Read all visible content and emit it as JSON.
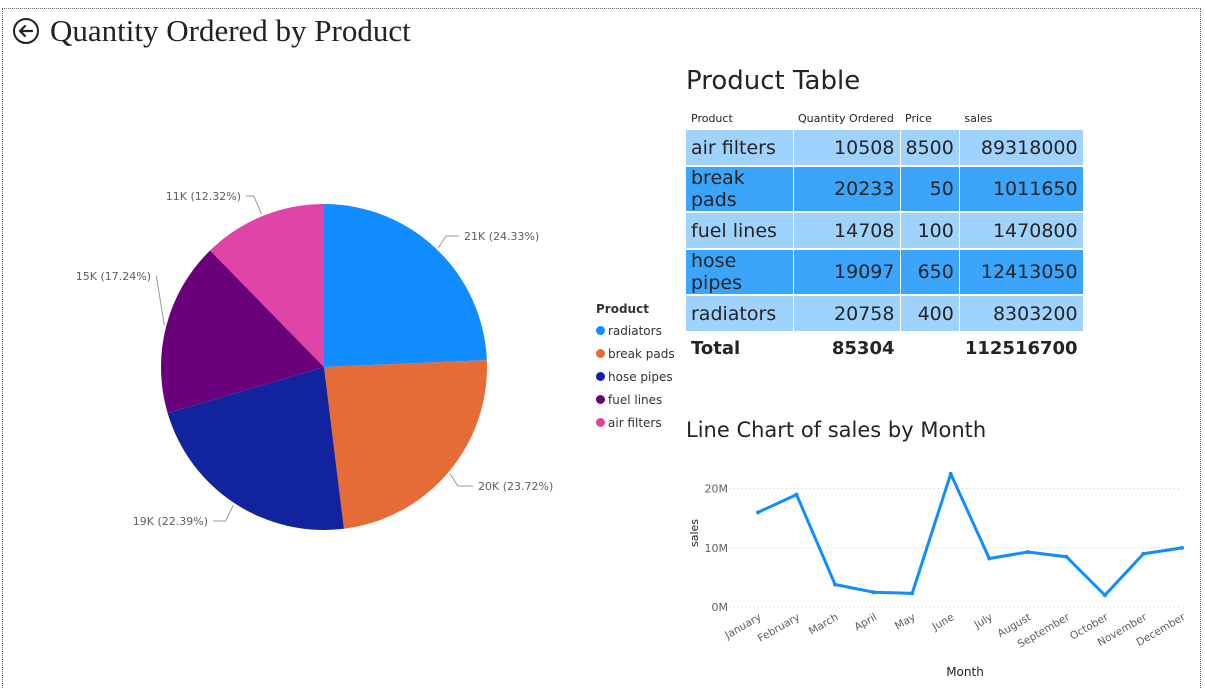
{
  "header": {
    "title": "Quantity Ordered by Product"
  },
  "pie": {
    "legend_title": "Product",
    "slices": [
      {
        "name": "radiators",
        "label": "21K (24.33%)",
        "color": "#118dff",
        "pct": 24.33
      },
      {
        "name": "break pads",
        "label": "20K (23.72%)",
        "color": "#e66c37",
        "pct": 23.72
      },
      {
        "name": "hose pipes",
        "label": "19K (22.39%)",
        "color": "#12239e",
        "pct": 22.39
      },
      {
        "name": "fuel lines",
        "label": "15K (17.24%)",
        "color": "#6b007b",
        "pct": 17.24
      },
      {
        "name": "air filters",
        "label": "11K (12.32%)",
        "color": "#e044a7",
        "pct": 12.32
      }
    ]
  },
  "table": {
    "title": "Product Table",
    "headers": [
      "Product",
      "Quantity Ordered",
      "Price",
      "sales"
    ],
    "rows": [
      [
        "air filters",
        "10508",
        "8500",
        "89318000"
      ],
      [
        "break pads",
        "20233",
        "50",
        "1011650"
      ],
      [
        "fuel lines",
        "14708",
        "100",
        "1470800"
      ],
      [
        "hose pipes",
        "19097",
        "650",
        "12413050"
      ],
      [
        "radiators",
        "20758",
        "400",
        "8303200"
      ]
    ],
    "total": {
      "label": "Total",
      "quantity": "85304",
      "price": "",
      "sales": "112516700"
    }
  },
  "chart_data": {
    "type": "line",
    "title": "Line Chart of sales by Month",
    "xlabel": "Month",
    "ylabel": "sales",
    "categories": [
      "January",
      "February",
      "March",
      "April",
      "May",
      "June",
      "July",
      "August",
      "September",
      "October",
      "November",
      "December"
    ],
    "values": [
      16000000,
      19000000,
      3800000,
      2500000,
      2300000,
      22500000,
      8200000,
      9300000,
      8500000,
      2000000,
      9000000,
      10000000
    ],
    "ylim": [
      0,
      24000000
    ],
    "yticks": [
      {
        "v": 0,
        "label": "0M"
      },
      {
        "v": 10000000,
        "label": "10M"
      },
      {
        "v": 20000000,
        "label": "20M"
      }
    ],
    "color": "#118dff",
    "grid": true
  }
}
